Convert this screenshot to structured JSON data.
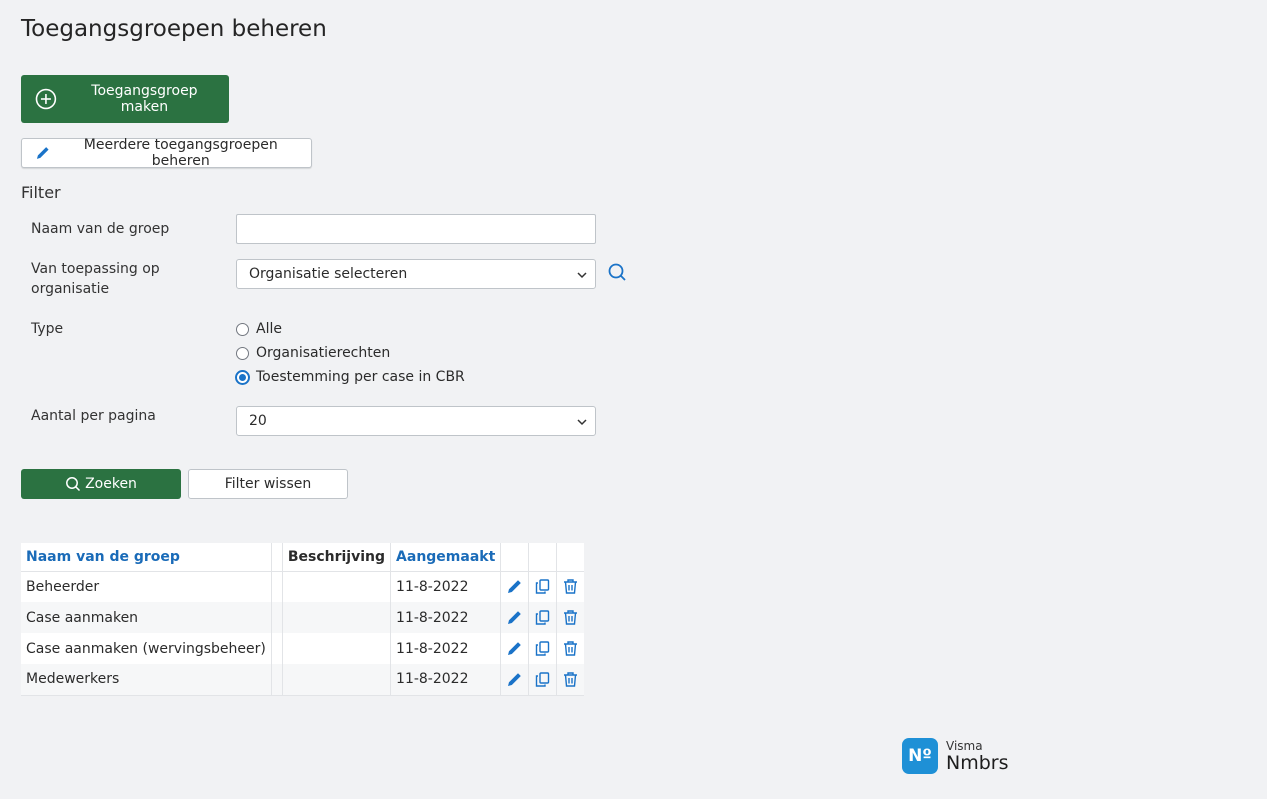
{
  "page": {
    "title": "Toegangsgroepen beheren"
  },
  "actions": {
    "create_label": "Toegangsgroep maken",
    "manage_multiple_label": "Meerdere toegangsgroepen beheren"
  },
  "filter": {
    "section_label": "Filter",
    "group_name_label": "Naam van de groep",
    "group_name_value": "",
    "organisation_label": "Van toepassing op organisatie",
    "organisation_selected": "Organisatie selecteren",
    "type_label": "Type",
    "type_options": [
      {
        "label": "Alle",
        "checked": false
      },
      {
        "label": "Organisatierechten",
        "checked": false
      },
      {
        "label": "Toestemming per case in CBR",
        "checked": true
      }
    ],
    "per_page_label": "Aantal per pagina",
    "per_page_selected": "20",
    "search_label": "Zoeken",
    "clear_label": "Filter wissen"
  },
  "table": {
    "columns": [
      "Naam van de groep",
      "",
      "Beschrijving",
      "Aangemaakt",
      "",
      "",
      ""
    ],
    "rows": [
      {
        "name": "Beheerder",
        "description": "",
        "created": "11-8-2022"
      },
      {
        "name": "Case aanmaken",
        "description": "",
        "created": "11-8-2022"
      },
      {
        "name": "Case aanmaken (wervingsbeheer)",
        "description": "",
        "created": "11-8-2022"
      },
      {
        "name": "Medewerkers",
        "description": "",
        "created": "11-8-2022"
      }
    ],
    "row_icons": [
      "edit-icon",
      "copy-icon",
      "trash-icon"
    ]
  },
  "brand": {
    "mark": "Nº",
    "line1": "Visma",
    "line2": "Nmbrs"
  },
  "colors": {
    "primary_green": "#2b7241",
    "link_blue": "#1a6bb8",
    "icon_blue": "#1a73c8",
    "brand_blue": "#1e90d6"
  }
}
